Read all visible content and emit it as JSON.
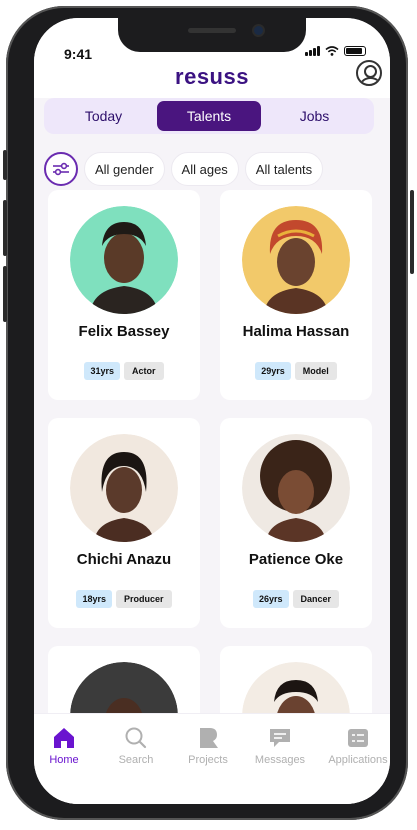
{
  "status": {
    "time": "9:41"
  },
  "app": {
    "logo": "resuss"
  },
  "tabs": [
    {
      "label": "Today",
      "active": false
    },
    {
      "label": "Talents",
      "active": true
    },
    {
      "label": "Jobs",
      "active": false
    }
  ],
  "filters": [
    "All gender",
    "All ages",
    "All talents"
  ],
  "talents": [
    {
      "name": "Felix Bassey",
      "age": "31yrs",
      "role": "Actor",
      "bg": "#7fe0be"
    },
    {
      "name": "Halima Hassan",
      "age": "29yrs",
      "role": "Model",
      "bg": "#f2c96a"
    },
    {
      "name": "Chichi Anazu",
      "age": "18yrs",
      "role": "Producer",
      "bg": "#f1e8df"
    },
    {
      "name": "Patience Oke",
      "age": "26yrs",
      "role": "Dancer",
      "bg": "#efe9e3"
    },
    {
      "name": "",
      "age": "",
      "role": "",
      "bg": "#3b3b3b"
    },
    {
      "name": "",
      "age": "",
      "role": "",
      "bg": "#f3ece4"
    }
  ],
  "nav": [
    {
      "label": "Home",
      "icon": "home-icon",
      "active": true
    },
    {
      "label": "Search",
      "icon": "search-icon",
      "active": false
    },
    {
      "label": "Projects",
      "icon": "projects-icon",
      "active": false
    },
    {
      "label": "Messages",
      "icon": "messages-icon",
      "active": false
    },
    {
      "label": "Applications",
      "icon": "applications-icon",
      "active": false
    }
  ],
  "colors": {
    "brand": "#4a157f",
    "accent": "#6a14cf"
  }
}
